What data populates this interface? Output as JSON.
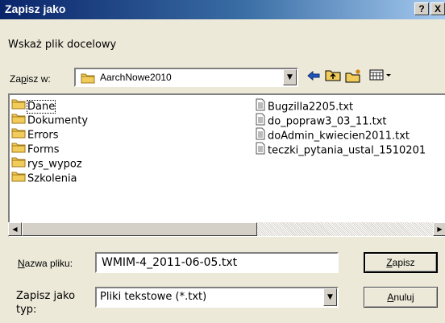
{
  "window": {
    "title": "Zapisz jako",
    "help_label": "?",
    "close_label": "X"
  },
  "prompt": "Wskaż plik docelowy",
  "save_in": {
    "label_pre": "Za",
    "label_accel": "p",
    "label_post": "isz w:",
    "value": "AarchNowe2010"
  },
  "toolbar": {
    "back_icon": "back-arrow-icon",
    "up_icon": "up-folder-icon",
    "new_icon": "new-folder-icon",
    "view_icon": "view-menu-icon"
  },
  "files": {
    "folders": [
      {
        "name": "Dane"
      },
      {
        "name": "Dokumenty"
      },
      {
        "name": "Errors"
      },
      {
        "name": "Forms"
      },
      {
        "name": "rys_wypoz"
      },
      {
        "name": "Szkolenia"
      }
    ],
    "documents": [
      {
        "name": "Bugzilla2205.txt"
      },
      {
        "name": "do_popraw3_03_11.txt"
      },
      {
        "name": "doAdmin_kwiecien2011.txt"
      },
      {
        "name": "teczki_pytania_ustal_1510201"
      }
    ]
  },
  "file_name": {
    "label_accel": "N",
    "label_post": "azwa pliku:",
    "value": "WMIM-4_2011-06-05.txt"
  },
  "file_type": {
    "label_line1": "Zapisz jako",
    "label_line2": "typ:",
    "value": "Pliki tekstowe (*.txt)"
  },
  "buttons": {
    "save": {
      "accel": "Z",
      "post": "apisz"
    },
    "cancel": {
      "accel": "A",
      "post": "nuluj"
    }
  },
  "colors": {
    "titlebar_start": "#0a246a",
    "titlebar_end": "#a6caf0",
    "dialog_bg": "#ece9d8",
    "folder": "#f2cc5a"
  }
}
